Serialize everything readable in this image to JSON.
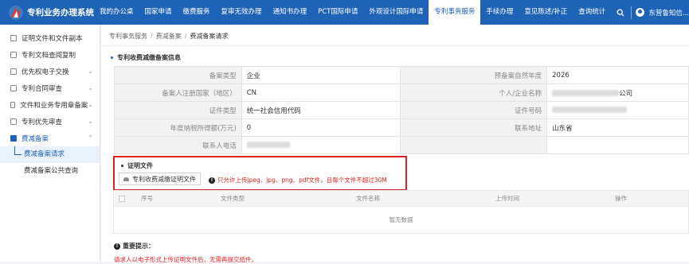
{
  "app": {
    "title": "专利业务办理系统"
  },
  "nav": {
    "items": [
      "我的办公桌",
      "国家申请",
      "缴费服务",
      "复审无效办理",
      "通知书办理",
      "PCT国际申请",
      "外观设计国际申请",
      "专利事务服务",
      "手续办理",
      "意见陈述/补正",
      "查询统计"
    ],
    "active_index": 7,
    "user_name": "东营鲁知信..."
  },
  "sidebar": {
    "items": [
      {
        "label": "证明文件和文件副本",
        "icon": "document-icon",
        "chevron": ""
      },
      {
        "label": "专利文档查阅复制",
        "icon": "copy-icon",
        "chevron": ""
      },
      {
        "label": "优先权电子交换",
        "icon": "exchange-icon",
        "chevron": "⌄"
      },
      {
        "label": "专利合同审查",
        "icon": "contract-icon",
        "chevron": "⌄"
      },
      {
        "label": "文件和业务专用章备案",
        "icon": "stamp-icon",
        "chevron": "⌄"
      },
      {
        "label": "专利优先审查",
        "icon": "priority-icon",
        "chevron": "⌄"
      }
    ],
    "open_group": {
      "label": "费减备案",
      "icon": "reduction-icon",
      "chevron": "⌃"
    },
    "sub_items": [
      "费减备案请求",
      "费减备案公共查询"
    ],
    "active_sub_index": 0
  },
  "breadcrumb": [
    "专利事务服务",
    "费减备案",
    "费减备案请求"
  ],
  "section_title": "专利收费减缴备案信息",
  "info": {
    "record_type_label": "备案类型",
    "record_type_value": "企业",
    "record_year_label": "预备案自然年度",
    "record_year_value": "2026",
    "country_label": "备案人注册国家（地区）",
    "country_value": "CN",
    "name_label": "个人/企业名称",
    "name_value_suffix": "公司",
    "cert_type_label": "证件类型",
    "cert_type_value": "统一社会信用代码",
    "cert_no_label": "证件号码",
    "income_label": "年度纳税所得额(万元)",
    "income_value": "0",
    "address_label": "联系地址",
    "address_value": "山东省",
    "phone_label": "联系人电话"
  },
  "evidence": {
    "title": "证明文件",
    "upload_label": "专利收费减缴证明文件",
    "note": "只允许上传jpeg、jpg、png、pdf文件，且每个文件不超过30M"
  },
  "file_table": {
    "columns": [
      "序号",
      "文件类型",
      "文件名称",
      "上传时间",
      "操作"
    ],
    "empty_text": "暂无数据"
  },
  "tips": {
    "title": "重要提示：",
    "text": "请求人以电子形式上传证明文件后，无需再提交纸件。"
  },
  "colors": {
    "primary": "#1e63b8",
    "alert_red": "#e02020"
  }
}
